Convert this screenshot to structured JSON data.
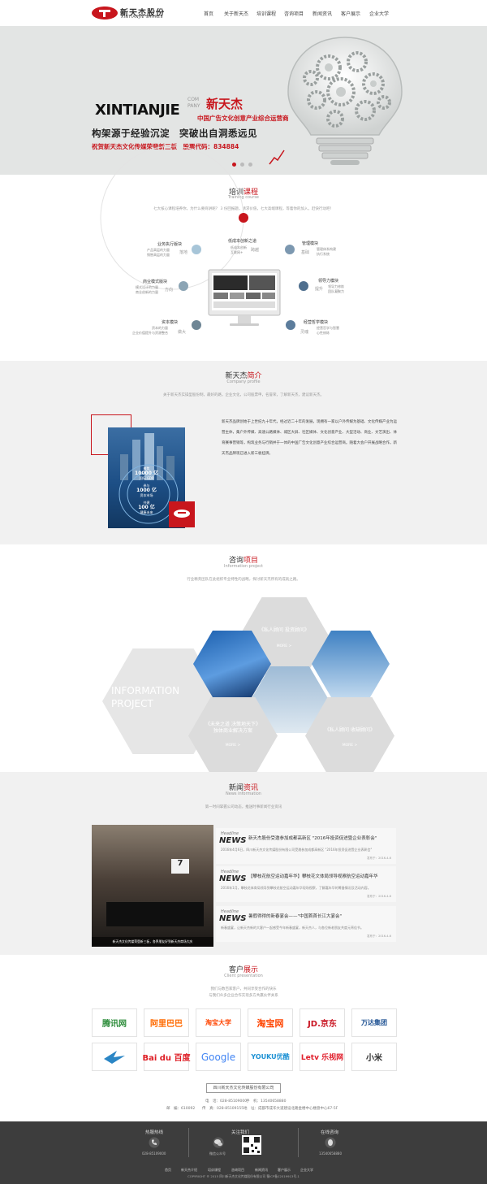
{
  "header": {
    "logo_cn": "新天杰股份",
    "logo_en": "XINTIANJIE SHARES",
    "nav": [
      "首页",
      "关于新天杰",
      "培训课程",
      "咨询项目",
      "新闻资讯",
      "客户展示",
      "企业大学"
    ]
  },
  "banner": {
    "title_en": "XINTIANJIE",
    "com": "COM",
    "pany": "PANY",
    "title_cn": "新天杰",
    "subtitle": "中国广告文化创意产业综合运营商",
    "slogan": "构架源于经验沉淀　突破出自洞悉远见",
    "listed": "祝贺新天杰文化传媒荣登新三板　股票代码：834884"
  },
  "training": {
    "title_a": "培训",
    "title_b": "课程",
    "en": "Training course",
    "desc": "七大核心课程培养你，为什么要商讲呢？ 3 份回报题，请求价值，七大高端课程，等着你的加入，赶快行动吧！",
    "nodes": [
      {
        "title": "低成本创新之道",
        "text": "低成本创新\n互联网+",
        "tag": "跨越"
      },
      {
        "title": "业务执行版块",
        "text": "产品高层的力量\n销售高层的力量",
        "tag": "落地"
      },
      {
        "title": "商业模式版块",
        "text": "模式设计的力量\n商业创新的力量",
        "tag": "方向"
      },
      {
        "title": "资本模块",
        "text": "资本的力量\n企业价值提升与资源整合",
        "tag": "做大"
      },
      {
        "title": "管理模块",
        "text": "管理体系构建\n执行系统",
        "tag": "基础"
      },
      {
        "title": "领导力模块",
        "text": "领导力修炼\n团队凝聚力",
        "tag": "提升"
      },
      {
        "title": "经营哲学模块",
        "text": "经营哲学与智慧\n心性修炼",
        "tag": "灵魂"
      }
    ]
  },
  "company": {
    "title_a": "新天杰",
    "title_b": "简介",
    "en": "Company profile",
    "desc": "关于新天杰实操型股份制，最好的路，企业文化，公司股票申，名誉荣，了解新天杰，建议新天杰。",
    "paragraph": "新天杰品牌创始于上世纪九十年代，经过近二十年的发展，现拥有一家以户外传媒为基础、文化传媒产业为运营主体，集户外传媒、高速公路媒体、城区大屏、社区媒体、文化创意产业、大型活动、商业、文艺演出、体育赛事营销等，构筑业务与行销并于一体的中国广告文化创意产业综合运营商。随着大会户开展战略合作，新天杰品牌现已进入新三板挂牌。",
    "book": {
      "l1": "聚焦",
      "v1": "10000 亿",
      "u1": "国际 GDP",
      "l2": "参与",
      "v2": "1000 亿",
      "u2": "资本市场",
      "l3": "共建",
      "v3": "100 亿",
      "u3": "健康未来"
    }
  },
  "consult": {
    "title_a": "咨询",
    "title_b": "项目",
    "en": "Information project",
    "desc": "行业精英团队在此组织专业特性的战略，探讨新天杰所有的成就之路。",
    "big": "INFORMATION PROJECT",
    "hex1": "《私人顾问 投资顾问》",
    "hex2": "《未来之道 决策地天下》\n独体商业解决方案",
    "hex3": "《私人顾问 收缺顾问》",
    "more": "MORE >"
  },
  "news": {
    "title_a": "新闻",
    "title_b": "资讯",
    "en": "News information",
    "desc": "第一时间掌握公司动态，推送时事新闻行业资讯",
    "photo_caption": "新天杰文化传媒荣登新三板，各界朋友好到新天杰商场大庆",
    "items": [
      {
        "logo1": "Headline",
        "logo2": "NEWS",
        "title": "新天杰股份受邀参加成都高新区 \"2016年投资促进暨企业表彰会\"",
        "desc": "2016年4月6日，四川新天杰文化传媒股份有限公司受邀参加成都高新区 \"2016年投资促进暨企业表彰会\"",
        "date": "发布于：2016-4-6"
      },
      {
        "logo1": "Headline",
        "logo2": "NEWS",
        "title": "【攀枝花航空运动嘉年华】攀枝花文体局领导视察航空运动嘉年华",
        "desc": "2016年1月，攀枝花体育局领导到攀枝花航空运动嘉年华现场视察，了解嘉年华的筹备情况及活动内容。",
        "date": "发布于：2016-4-6"
      },
      {
        "logo1": "Headline",
        "logo2": "NEWS",
        "title": "暑假得得的新春宴会——\"中国首首长江大宴会\"",
        "desc": "新春盛宴，让新天杰新的大客户一起感受今年新春盛宴，新天杰人，与各位新老朋友共度元宵佳节。",
        "date": "发布于：2016-4-6"
      }
    ]
  },
  "clients": {
    "title_a": "客户",
    "title_b": "展示",
    "en": "Client presentation",
    "desc1": "我们与数百家客户，共同享受合作的快乐",
    "desc2": "与我们众多企业合作实现多方共赢伙伴关系",
    "logos": [
      "腾讯网",
      "阿里巴巴",
      "淘宝大学",
      "淘宝网",
      "JD.京东",
      "万达集团",
      "BIRD",
      "Bai du 百度",
      "Google",
      "YOUKU优酷",
      "Letv 乐视网",
      "小米"
    ]
  },
  "contact": {
    "company": "四川新天杰文化传媒股份有限公司",
    "phone": "电　话：028-85109000",
    "mobile": "手　机：13540658880",
    "zip": "邮　编：610092",
    "fax": "传　真：028-85109155",
    "address": "地　址：成都市成华大道建设北路金楼中心楼盘中心67-5F"
  },
  "footer": {
    "hotline_t": "热服热线",
    "hotline": "028-85109000",
    "follow_t": "关注我们",
    "wechat": "微信公众号",
    "online_t": "在线咨询",
    "qq": "13540658880",
    "nav": [
      "首页",
      "新天杰介绍",
      "培训课程",
      "咨询项目",
      "新闻资讯",
      "客户展示",
      "企业大学"
    ],
    "copyright": "COPYRIGHT ® 2015 四川新天杰文化传媒股份有限公司 蜀ICP备12019913号-1"
  }
}
